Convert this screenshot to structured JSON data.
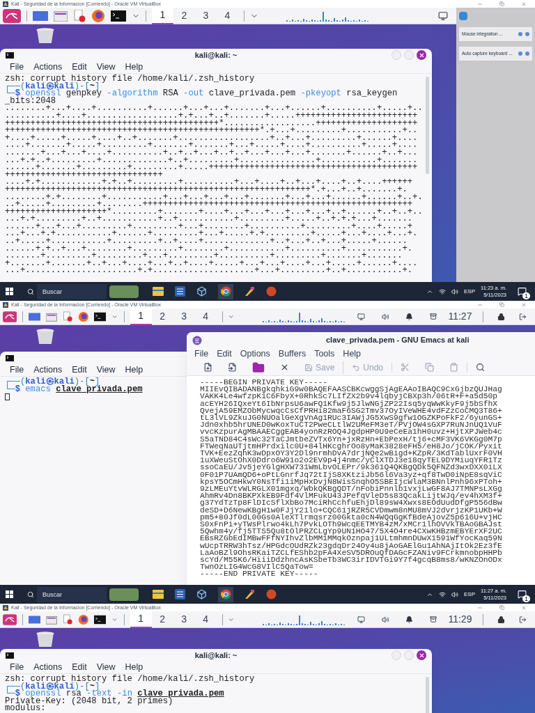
{
  "screens": [
    {
      "window_title": "Kali - Seguridad de la Informacion [Corriendo] - Oracle VM VirtualBox",
      "workspaces": [
        {
          "label": "1",
          "selected": true
        },
        {
          "label": "2",
          "selected": false
        },
        {
          "label": "3",
          "selected": false
        },
        {
          "label": "4",
          "selected": false
        }
      ],
      "notifications": [
        {
          "text": "Mouse integration ..."
        },
        {
          "text": "Auto capture keyboard ..."
        }
      ],
      "terminal": {
        "title": "kali@kali: ~",
        "menu": [
          "File",
          "Actions",
          "Edit",
          "View",
          "Help"
        ],
        "lines": [
          {
            "kind": "text",
            "text": "zsh: corrupt history file /home/kali/.zsh_history"
          },
          {
            "kind": "prompt",
            "frame": "┌──(",
            "user": "kali㉿kali",
            "sep": ")-[",
            "dir": "~",
            "close": "]"
          },
          {
            "kind": "command",
            "frame": "└─",
            "marker": "$",
            "tokens": [
              {
                "text": "openssl",
                "kind": "command"
              },
              {
                "text": "genpkey",
                "kind": "arg"
              },
              {
                "text": "-algorithm",
                "kind": "option"
              },
              {
                "text": "RSA",
                "kind": "arg"
              },
              {
                "text": "-out",
                "kind": "option"
              },
              {
                "text": "clave_privada.pem",
                "kind": "arg"
              },
              {
                "text": "-pkeyopt",
                "kind": "option"
              },
              {
                "text": "rsa_keygen",
                "kind": "arg"
              }
            ]
          },
          {
            "kind": "text",
            "text": "_bits:2048"
          },
          {
            "kind": "text",
            "text": "........+...+....+..........+......+...+...+.......+...+......+..........+.....+.."
          },
          {
            "kind": "text",
            "text": "..........+....+..................+.+...+..+.......+.....++++++++++++++++++++++++"
          },
          {
            "kind": "text",
            "text": "++++++++++++++++++++++++++++++++++++++++++*..................++++++++++++++++++++"
          },
          {
            "kind": "text",
            "text": "++++++++++++++++++++++++++++++++++++++++++++++++++*.+...+.........+...........+.."
          },
          {
            "kind": "text",
            "text": "+....+.....+.....+....+..+.......+..................+..+...+.........+......+...."
          },
          {
            "kind": "text",
            "text": "....+.......+.....+.........+.......+.......+...+.....+....+..........+.....+...."
          },
          {
            "kind": "text",
            "text": ".......+...+...+....+..........+..+..+...+..+..+...+...+...+.......+......+..+..."
          },
          {
            "kind": "text",
            "text": "...+.+..+.........+.............+..+.........+...............+...........+......."
          },
          {
            "kind": "text",
            "text": "......+.......+.........+.........+.....+++++++++++++++++++++++++++++++++++++++++"
          },
          {
            "kind": "text",
            "text": "+++++++++++++++++++++++++++++++"
          },
          {
            "kind": "text",
            "text": "....+.+............+.+..+.........+..........+...+....+..+...+....+..+....++++++"
          },
          {
            "kind": "text",
            "text": "++++++++++++++++++++++++++++++++++++++++++++++++++++++++++++*.+...+..+.......+."
          },
          {
            "kind": "text",
            "text": "........+.+........+...........+...+...+...+...+.......+...+...+......+......+..+."
          },
          {
            "kind": "text",
            "text": "..+.....+.........+........+++++++++++++++++++++++++++++++++++++++++++++++++++++"
          },
          {
            "kind": "text",
            "text": "++++++++++++++++++++*.........+.......+....+...+...+...+...+...+..+......+..+..+.."
          },
          {
            "kind": "text",
            "text": "...+.+.........+..+...........+..+...........+.........+.....+..+.+.+...+......."
          },
          {
            "kind": "text",
            "text": "......+...+...+.........+.........+...+........+..........+.........+....+.....+"
          },
          {
            "kind": "text",
            "text": "...+...+.+...........+......+.........+...+.....+.+.........+.....+...+....+...+."
          },
          {
            "kind": "text",
            "text": "..+.....+...........+.........+..+....+.............+..+...+..+...+.....+......"
          },
          {
            "kind": "text",
            "text": "......+.+..+...+........+.........+........+...........+..........+...........+."
          },
          {
            "kind": "text",
            "text": ".......+.........+.........+...+.........+..........+.........+.......+......."
          },
          {
            "kind": "text",
            "text": "+.......+.......+..+...+....+...+..+....+.....+...+...+....+...+.....+......+...."
          },
          {
            "kind": "text",
            "text": "...+......................+.+....................+...+.........+..+...........+."
          }
        ]
      },
      "taskbar": {
        "search_placeholder": "Buscar",
        "language": "ESP",
        "time": "11:23 a. m.",
        "date": "5/11/2023",
        "badge": "1"
      }
    },
    {
      "window_title": "Kali - Seguridad de la Informacion [Corriendo] - Oracle VM VirtualBox",
      "workspaces": [
        {
          "label": "1",
          "selected": true
        },
        {
          "label": "2",
          "selected": false
        },
        {
          "label": "3",
          "selected": false
        },
        {
          "label": "4",
          "selected": false
        }
      ],
      "clock": "11:27",
      "terminal": {
        "menu": [
          "File",
          "Actions",
          "Edit",
          "View",
          "Help"
        ],
        "lines": [
          {
            "kind": "prompt",
            "frame": "┌──(",
            "user": "kali㉿kali",
            "sep": ")-[",
            "dir": "~",
            "close": "]"
          },
          {
            "kind": "command",
            "frame": "└─",
            "marker": "$",
            "tokens": [
              {
                "text": "emacs",
                "kind": "command"
              },
              {
                "text": "clave_privada.pem",
                "kind": "file"
              }
            ]
          },
          {
            "kind": "cursor"
          }
        ]
      },
      "emacs": {
        "title": "clave_privada.pem - GNU Emacs at kali",
        "menu": [
          "File",
          "Edit",
          "Options",
          "Buffers",
          "Tools",
          "Help"
        ],
        "toolbar_groups": [
          {
            "items": [
              {
                "kind": "new",
                "disabled": false
              },
              {
                "kind": "open",
                "disabled": false
              },
              {
                "kind": "folder",
                "disabled": false
              },
              {
                "kind": "close",
                "disabled": false
              },
              {
                "kind": "save",
                "label": "Save",
                "disabled": true
              }
            ]
          },
          {
            "items": [
              {
                "kind": "undo",
                "label": "Undo",
                "disabled": true
              }
            ]
          },
          {
            "items": [
              {
                "kind": "cut",
                "disabled": true
              },
              {
                "kind": "copy",
                "disabled": true
              },
              {
                "kind": "paste",
                "disabled": true
              }
            ]
          },
          {
            "items": [
              {
                "kind": "search",
                "disabled": false
              }
            ]
          }
        ],
        "lines": [
          "-----BEGIN PRIVATE KEY-----",
          "MIIEvQIBADANBgkqhkiG9w0BAQEFAASCBKcwggSjAgEAAoIBAQC9CxGjbzQUJHag",
          "VAKK4Le4wfzpK1C6FbyX+0RhkSc7LIfZX2b9v4lqbyjCBXp3h/06tR+F+a5d50p",
          "acEYH26IQxeYt6IbNrpsU6awFQ1Kfw9j5JlwNGjZP22Isq5yqWwKkyF9j5bSfhX",
          "QvejA59EMZObMycwqcCsCfPRHi82maF6SG2Tmv37OyIVeWHE4vdFZzCoCMQ3T86+",
          "tL3lVL9ZkuJG0NUOalGeXgVnAg1RUc3IAWjJG5XwS9gfw1OGZKPoFkF2/6yunGS+",
          "Jdn0xhb5hrUNED0wKoxTuCT2PweCLtlW2UMeFM3eT/PVjOW4sGXP7RuNJnUQ1VuF",
          "vvcKzpurAgMBAAECggEAB4yonRzROQ4JgdpHP0U9eCeEa1hH0uvz+HjtXPJWeb4c",
          "S5aTND84C4sWc32TaCJmtbeZVTx6Yn+jxRzHn+EbPexH/tj6+cMF3VK6VKGg0M7p",
          "FTWeqNaUTjtmHPrdxilc0U+84lHKcghrOo8yMaK3828eFH5/eH8Jo/jCOK/Pyxit",
          "TVK+EezZqhK3wDpxOY3Y2Dl9nrmhDvA7drjNQe2wBigd+KZpR/3KdTablUxrF0VH",
          "1uXWeuStOhX0Ddro6W91o2o2EV9p4j4nmc/yClXTDJ3e18qyTEL9DYMiuqYFR1Tz",
          "ssoCaEU/Jv5jeYGlgHXW731WmLbvOLEPr/9k361Q4QKBgQDk5QFNZd3wxDXX0iLX",
          "0F01P7UAmQD6+oPtLGnrfJq72tIjS8XKtziJb56l6Va3yz+qf8TwD0iNpE8sqViC",
          "kpsY5OCmHkwY0NsTfi1iMpHxDvjN8WisSnqhO5SBEIjcWlaM3BNnlPnh96xPToh+",
          "9zLMEuYtvWLRGLX01mgxq/WbkQKBgQDT/nFobiPnnlb1vxjLwGF8AJ7TMNPsLXGg",
          "AhmRv4Dn8BKPXkEB9Fdf4VlMFukU43JPefqVleD5s83QcakLijtWJq/ev4hXM3f+",
          "g37YdTzTp8FlDIcSflXbBo7MciRhCchfuEhjDl89sW4Xwxs8EOdUudDfgP556dBw",
          "deSD+D6NewKBgH1w0FJjY21lo+CQC61jRZR5CVDmwm8nMU8mVJ2dvrjzKP1UKb+W",
          "pm5+80Jf0dL00Gs0AleXTlrmqsrz00Gkta0cN4WQqGgKfBdeAjovZ5p616U+vjHC",
          "S0xFnPi+yTWsPlrwo4kLh7PvkLOTh9WcqEETMYB4zM/xMCr1lhOVVkTBAoGBAJst",
          "5Qwhm4y/fj5TTS5Qu8tOlPRZCLgYp9UN1HO47/5X4O4re4CXwKHBzmEBYErXF2UC",
          "EBsRZGbEdIMBwFFfNYIhvZlbMM1MMqkOznpaj1ULtmhmnDUwX1591WfYocKaq59N",
          "wUcpTRRW3hTsz/HPGdcOUdRZk23gdqDr24Oy4u8jAoGAElGu1AhNAjItOk2Ez3fE",
          "LaAoBZl9OhsRKaiTZCLfEShb2pFA4XeSV5DROuQfDAGcFZANiv9FCrkmnobpHHPb",
          "scYd/M55K6/HiiiDdzhncAsKSbeTb3WC3irIDVTGi9Y7f4gcqB8ms8/wKNZOnODx",
          "TwnOzLIG4WcG8VIlC5QaTow=",
          "-----END PRIVATE KEY-----"
        ]
      },
      "taskbar": {
        "search_placeholder": "Buscar",
        "language": "ESP",
        "time": "11:27 a. m.",
        "date": "5/11/2023",
        "badge": "1"
      }
    },
    {
      "window_title": "Kali - Seguridad de la Informacion [Corriendo] - Oracle VM VirtualBox",
      "workspaces": [
        {
          "label": "1",
          "selected": true
        },
        {
          "label": "2",
          "selected": false
        },
        {
          "label": "3",
          "selected": false
        },
        {
          "label": "4",
          "selected": false
        }
      ],
      "clock": "11:29",
      "terminal": {
        "title": "kali@kali: ~",
        "menu": [
          "File",
          "Actions",
          "Edit",
          "View",
          "Help"
        ],
        "lines": [
          {
            "kind": "text",
            "text": "zsh: corrupt history file /home/kali/.zsh_history"
          },
          {
            "kind": "prompt",
            "frame": "┌──(",
            "user": "kali㉿kali",
            "sep": ")-[",
            "dir": "~",
            "close": "]"
          },
          {
            "kind": "command",
            "frame": "└─",
            "marker": "$",
            "tokens": [
              {
                "text": "openssl",
                "kind": "command"
              },
              {
                "text": "rsa",
                "kind": "arg"
              },
              {
                "text": "-text",
                "kind": "option"
              },
              {
                "text": "-in",
                "kind": "option"
              },
              {
                "text": "clave_privada.pem",
                "kind": "file"
              }
            ]
          },
          {
            "kind": "text",
            "text": "Private-Key: (2048 bit, 2 primes)"
          },
          {
            "kind": "text",
            "text": "modulus:"
          }
        ]
      }
    }
  ]
}
